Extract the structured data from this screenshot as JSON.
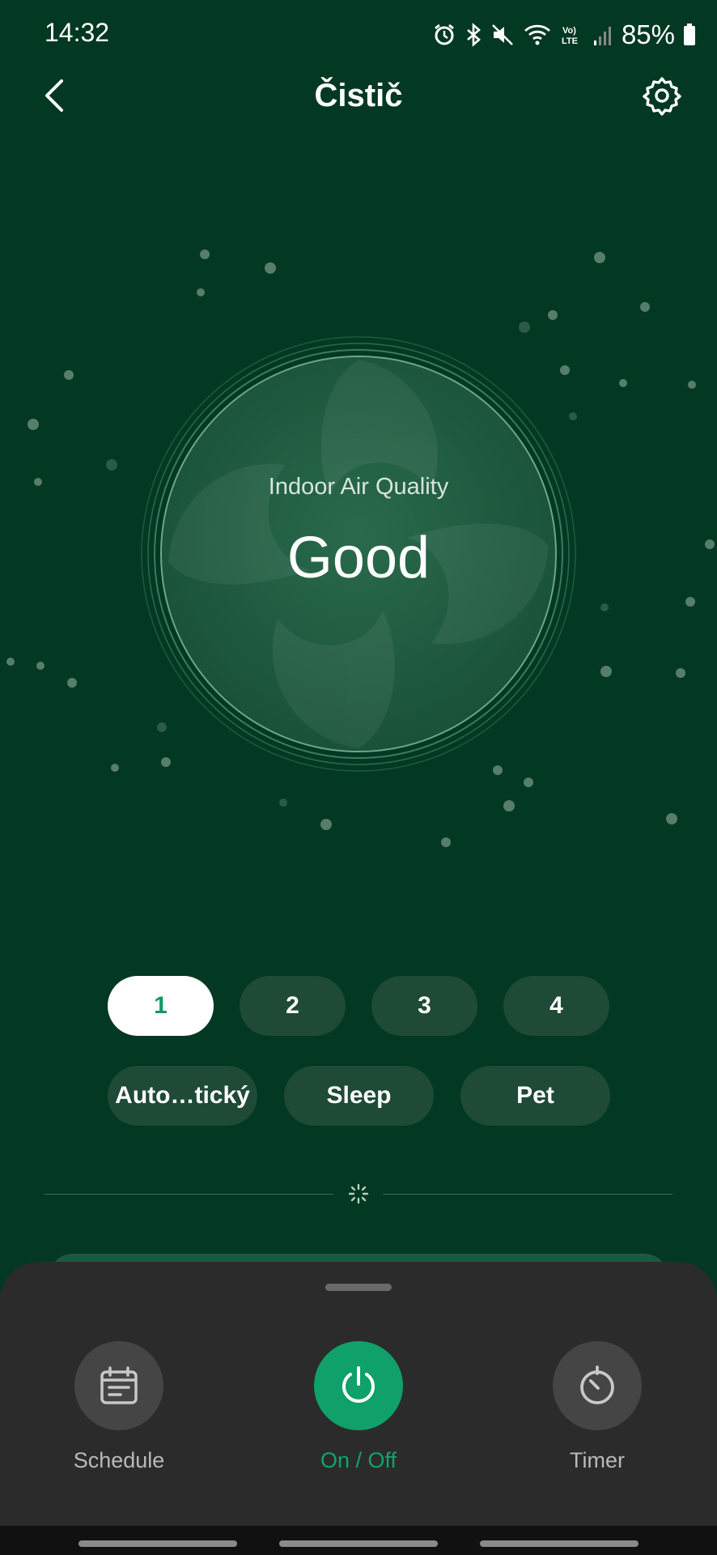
{
  "status_bar": {
    "time": "14:32",
    "battery": "85%",
    "icons": [
      "alarm-icon",
      "bluetooth-icon",
      "mute-icon",
      "wifi-icon",
      "volte-icon",
      "signal-icon",
      "battery-icon"
    ]
  },
  "header": {
    "title": "Čistič",
    "back_icon": "chevron-left-icon",
    "settings_icon": "gear-icon"
  },
  "air_quality": {
    "label": "Indoor Air Quality",
    "value": "Good"
  },
  "fan_speeds": {
    "selected": "1",
    "options": [
      "1",
      "2",
      "3",
      "4"
    ]
  },
  "modes": [
    "Auto…tický",
    "Sleep",
    "Pet"
  ],
  "bottom_sheet": {
    "actions": [
      {
        "label": "Schedule",
        "icon": "calendar-icon"
      },
      {
        "label": "On / Off",
        "icon": "power-icon"
      },
      {
        "label": "Timer",
        "icon": "timer-icon"
      }
    ]
  },
  "colors": {
    "background": "#033822",
    "accent": "#10a06a",
    "sheet": "#2b2b2b",
    "chip": "#1e4a36"
  }
}
